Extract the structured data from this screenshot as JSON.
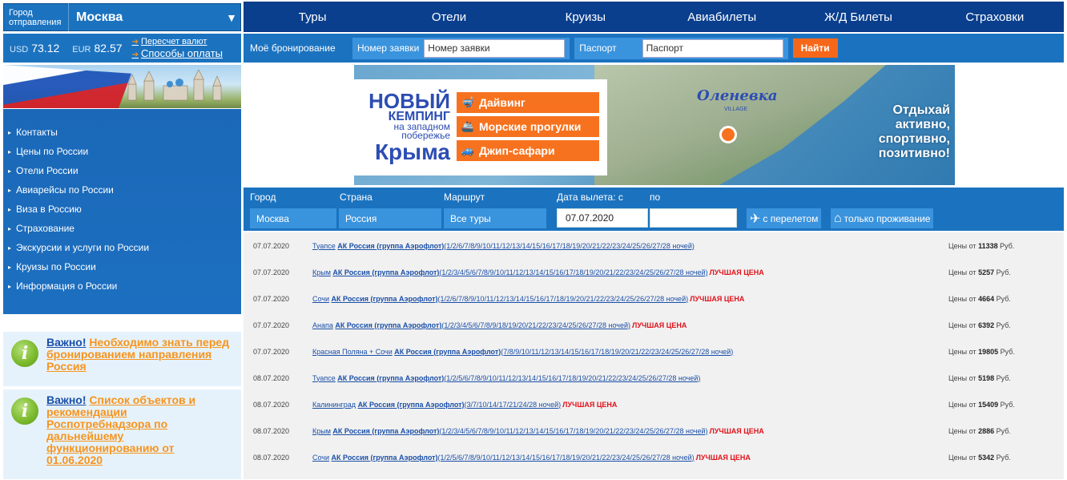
{
  "city": {
    "label_line1": "Город",
    "label_line2": "отправления",
    "value": "Москва"
  },
  "topnav": [
    "Туры",
    "Отели",
    "Круизы",
    "Авиабилеты",
    "Ж/Д Билеты",
    "Страховки"
  ],
  "rates": {
    "usd_code": "USD",
    "usd_value": "73.12",
    "eur_code": "EUR",
    "eur_value": "82.57",
    "link_recalc": "Пересчет валют",
    "link_payment": "Способы оплаты"
  },
  "booking": {
    "title": "Моё бронирование",
    "order_label": "Номер заявки",
    "order_placeholder": "Номер заявки",
    "passport_label": "Паспорт",
    "passport_placeholder": "Паспорт",
    "find_button": "Найти"
  },
  "side_menu": [
    "Контакты",
    "Цены по России",
    "Отели России",
    "Авиарейсы по России",
    "Виза в Россию",
    "Страхование",
    "Экскурсии и услуги по России",
    "Круизы по России",
    "Информация о России"
  ],
  "notices": [
    {
      "important": "Важно!",
      "message": "Необходимо знать перед бронированием направления Россия"
    },
    {
      "important": "Важно!",
      "message": "Список объектов и рекомендации Роспотребнадзора по дальнейшему функционированию от 01.06.2020"
    }
  ],
  "promo": {
    "title_1": "НОВЫЙ",
    "title_2": "КЕМПИНГ",
    "title_3": "на западном",
    "title_4": "побережье",
    "title_5": "Крыма",
    "options": [
      "Дайвинг",
      "Морские прогулки",
      "Джип-сафари"
    ],
    "brand": "Оленевка",
    "brand_sub": "VILLAGE",
    "slogan_1": "Отдыхай",
    "slogan_2": "активно,",
    "slogan_3": "спортивно,",
    "slogan_4": "позитивно!"
  },
  "search": {
    "city_label": "Город",
    "country_label": "Страна",
    "route_label": "Маршрут",
    "date_label": "Дата вылета: с",
    "date_to_label": "по",
    "city_value": "Москва",
    "country_value": "Россия",
    "route_value": "Все туры",
    "date_from": "07.07.2020",
    "date_to": "",
    "with_flight": "с перелетом",
    "only_stay": "только проживание"
  },
  "tours": [
    {
      "date": "07.07.2020",
      "dest": "Туапсе",
      "airline": "АК Россия (группа Аэрофлот)",
      "nights": "(1/2/6/7/8/9/10/11/12/13/14/15/16/17/18/19/20/21/22/23/24/25/26/27/28 ночей)",
      "best": "",
      "price_prefix": "Цены от",
      "price": "11338",
      "currency": "Руб."
    },
    {
      "date": "07.07.2020",
      "dest": "Крым",
      "airline": "АК Россия (группа Аэрофлот)",
      "nights": "(1/2/3/4/5/6/7/8/9/10/11/12/13/14/15/16/17/18/19/20/21/22/23/24/25/26/27/28 ночей)",
      "best": "ЛУЧШАЯ ЦЕНА",
      "price_prefix": "Цены от",
      "price": "5257",
      "currency": "Руб."
    },
    {
      "date": "07.07.2020",
      "dest": "Сочи",
      "airline": "АК Россия (группа Аэрофлот)",
      "nights": "(1/2/6/7/8/9/10/11/12/13/14/15/16/17/18/19/20/21/22/23/24/25/26/27/28 ночей)",
      "best": "ЛУЧШАЯ ЦЕНА",
      "price_prefix": "Цены от",
      "price": "4664",
      "currency": "Руб."
    },
    {
      "date": "07.07.2020",
      "dest": "Анапа",
      "airline": "АК Россия (группа Аэрофлот)",
      "nights": "(1/2/3/4/5/6/7/8/9/18/19/20/21/22/23/24/25/26/27/28 ночей)",
      "best": "ЛУЧШАЯ ЦЕНА",
      "price_prefix": "Цены от",
      "price": "6392",
      "currency": "Руб."
    },
    {
      "date": "07.07.2020",
      "dest": "Красная Поляна + Сочи",
      "airline": "АК Россия (группа Аэрофлот)",
      "nights": "(7/8/9/10/11/12/13/14/15/16/17/18/19/20/21/22/23/24/25/26/27/28 ночей)",
      "best": "",
      "price_prefix": "Цены от",
      "price": "19805",
      "currency": "Руб."
    },
    {
      "date": "08.07.2020",
      "dest": "Туапсе",
      "airline": "АК Россия (группа Аэрофлот)",
      "nights": "(1/2/5/6/7/8/9/10/11/12/13/14/15/16/17/18/19/20/21/22/23/24/25/26/27/28 ночей)",
      "best": "",
      "price_prefix": "Цены от",
      "price": "5198",
      "currency": "Руб."
    },
    {
      "date": "08.07.2020",
      "dest": "Калининград",
      "airline": "АК Россия (группа Аэрофлот)",
      "nights": "(3/7/10/14/17/21/24/28 ночей)",
      "best": "ЛУЧШАЯ ЦЕНА",
      "price_prefix": "Цены от",
      "price": "15409",
      "currency": "Руб."
    },
    {
      "date": "08.07.2020",
      "dest": "Крым",
      "airline": "АК Россия (группа Аэрофлот)",
      "nights": "(1/2/3/4/5/6/7/8/9/10/11/12/13/14/15/16/17/18/19/20/21/22/23/24/25/26/27/28 ночей)",
      "best": "ЛУЧШАЯ ЦЕНА",
      "price_prefix": "Цены от",
      "price": "2886",
      "currency": "Руб."
    },
    {
      "date": "08.07.2020",
      "dest": "Сочи",
      "airline": "АК Россия (группа Аэрофлот)",
      "nights": "(1/2/5/6/7/8/9/10/11/12/13/14/15/16/17/18/19/20/21/22/23/24/25/26/27/28 ночей)",
      "best": "ЛУЧШАЯ ЦЕНА",
      "price_prefix": "Цены от",
      "price": "5342",
      "currency": "Руб."
    }
  ]
}
